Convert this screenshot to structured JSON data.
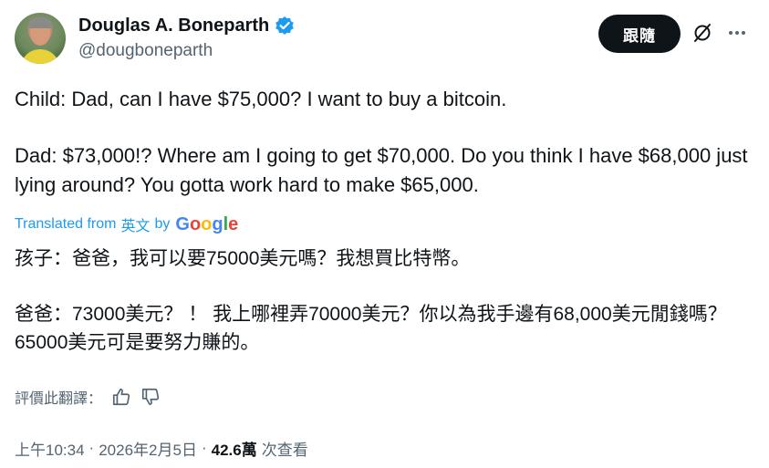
{
  "author": {
    "display_name": "Douglas A. Boneparth",
    "handle": "@dougboneparth",
    "verified_color": "#1d9bf0"
  },
  "actions": {
    "follow_label": "跟隨",
    "grok_icon": "grok-icon",
    "more_icon": "more-icon"
  },
  "tweet": {
    "line1": "Child: Dad, can I have $75,000? I want to buy a bitcoin.",
    "line2": "Dad: $73,000!? Where am I going to get $70,000. Do you think I have $68,000 just lying around? You gotta work hard to make $65,000."
  },
  "translation_notice": {
    "prefix": "Translated from",
    "language": "英文",
    "by": "by",
    "provider": "Google"
  },
  "translation": {
    "line1": "孩子：爸爸，我可以要75000美元嗎？我想買比特幣。",
    "line2": "爸爸：73000美元？ ！ 我上哪裡弄70000美元？你以為我手邊有68,000美元閒錢嗎？ 65000美元可是要努力賺的。"
  },
  "rating": {
    "label": "評價此翻譯："
  },
  "meta": {
    "time": "上午10:34",
    "date": "2026年2月5日",
    "dot": "·",
    "views_count": "42.6萬",
    "views_label": "次查看"
  }
}
